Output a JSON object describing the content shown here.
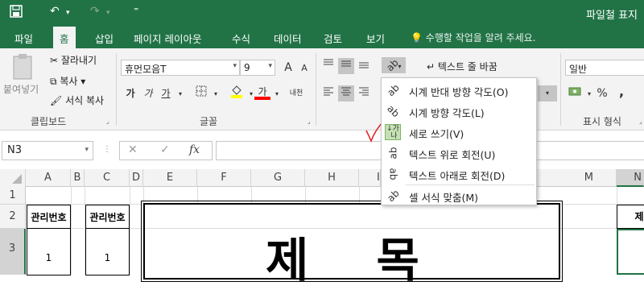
{
  "titlebar": {
    "title": "파일철 표지"
  },
  "tabs": [
    "파일",
    "홈",
    "삽입",
    "페이지 레이아웃",
    "수식",
    "데이터",
    "검토",
    "보기"
  ],
  "active_tab": "홈",
  "tell_me": "수행할 작업을 알려 주세요.",
  "clipboard": {
    "paste": "붙여넣기",
    "cut": "잘라내기",
    "copy": "복사",
    "format_painter": "서식 복사",
    "label": "클립보드"
  },
  "font": {
    "name": "휴먼모음T",
    "size": "9",
    "bold": "가",
    "italic": "가",
    "underline": "가",
    "font_color_btn": "가",
    "label": "글꼴"
  },
  "alignment": {
    "wrap_text": "텍스트 줄 바꿈"
  },
  "number": {
    "format": "일반",
    "percent": "%",
    "comma": ",",
    "label": "표시 형식"
  },
  "menu": {
    "items": [
      {
        "label": "시계 반대 방향 각도(O)"
      },
      {
        "label": "시계 방향 각도(L)"
      },
      {
        "label": "세로 쓰기(V)"
      },
      {
        "label": "텍스트 위로 회전(U)"
      },
      {
        "label": "텍스트 아래로 회전(D)"
      },
      {
        "label": "셀 서식 맞춤(M)"
      }
    ]
  },
  "formula_bar": {
    "name_box": "N3",
    "fx": "fx",
    "cancel": "✕",
    "enter": "✓"
  },
  "sheet": {
    "columns": [
      "A",
      "B",
      "C",
      "D",
      "E",
      "F",
      "G",
      "H",
      "I",
      "M",
      "N"
    ],
    "rows": [
      "1",
      "2",
      "3"
    ],
    "cells": {
      "A2": "관리번호",
      "C2": "관리번호",
      "A3": "1",
      "C3": "1",
      "E3": "제 목",
      "N2": "제"
    }
  },
  "colors": {
    "brand": "#217346",
    "annotation": "#e02020"
  }
}
